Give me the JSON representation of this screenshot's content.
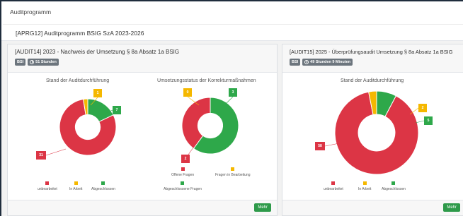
{
  "header": {
    "title": "Auditprogramm",
    "program": "[APRG12] Auditprogramm BSIG SzA 2023-2026"
  },
  "colors": {
    "red": "#dc3545",
    "yellow": "#f5b800",
    "green": "#2ea84a",
    "button": "#2e9a4a",
    "badge": "#6c757d"
  },
  "cards": [
    {
      "title": "[AUDIT14] 2023 - Nachweis der Umsetzung § 8a Absatz 1a BSIG",
      "badge_scope": "BSI",
      "badge_time": "51 Stunden",
      "more": "Mehr",
      "charts": [
        {
          "title": "Stand der Auditdurchführung",
          "legend": [
            "unbearbeitet",
            "In Arbeit",
            "Abgeschlossen"
          ]
        },
        {
          "title": "Umsetzungsstatus der Korrekturmaßnahmen",
          "legend": [
            "Offene Fragen",
            "Fragen in Bearbeitung",
            "Abgeschlossene Fragen"
          ]
        }
      ]
    },
    {
      "title": "[AUDIT15] 2025 - Überprüfungsaudit Umsetzung § 8a Absatz 1a BSIG",
      "badge_scope": "BSI",
      "badge_time": "49 Stunden 9 Minuten",
      "more": "Mehr",
      "charts": [
        {
          "title": "Stand der Auditdurchführung",
          "legend": [
            "unbearbeitet",
            "In Arbeit",
            "Abgeschlossen"
          ]
        }
      ]
    }
  ],
  "chart_data": [
    {
      "type": "pie",
      "title": "Stand der Auditdurchführung",
      "categories": [
        "unbearbeitet",
        "In Arbeit",
        "Abgeschlossen"
      ],
      "values": [
        31,
        1,
        7
      ],
      "labels": [
        "31",
        "1",
        "7"
      ],
      "donut": true,
      "legend": "bottom"
    },
    {
      "type": "pie",
      "title": "Umsetzungsstatus der Korrekturmaßnahmen",
      "categories": [
        "Offene Fragen",
        "Fragen in Bearbeitung",
        "Abgeschlossene Fragen"
      ],
      "values": [
        2,
        0,
        3
      ],
      "labels": [
        "2",
        "0",
        "3"
      ],
      "donut": true,
      "legend": "bottom"
    },
    {
      "type": "pie",
      "title": "Stand der Auditdurchführung",
      "categories": [
        "unbearbeitet",
        "In Arbeit",
        "Abgeschlossen"
      ],
      "values": [
        58,
        2,
        5
      ],
      "labels": [
        "58",
        "2",
        "5"
      ],
      "donut": true,
      "legend": "bottom"
    }
  ]
}
